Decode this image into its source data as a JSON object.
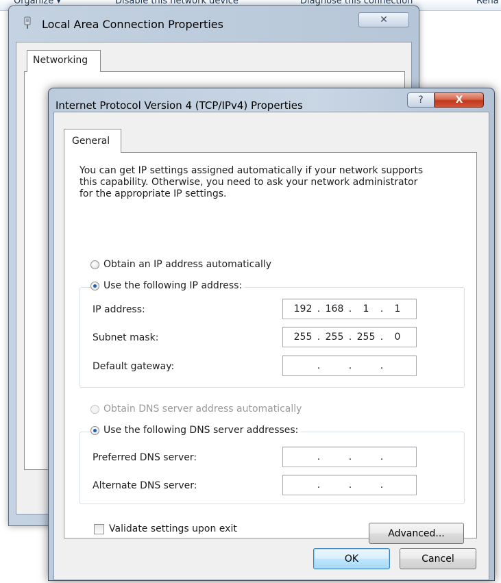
{
  "background_toolbar": {
    "organize": "Organize ▾",
    "disable_device": "Disable this network device",
    "diagnose": "Diagnose this connection",
    "rename": "Rena"
  },
  "back_window": {
    "title": "Local Area Connection Properties",
    "close_glyph": "✕",
    "tab_networking": "Networking"
  },
  "dialog": {
    "title": "Internet Protocol Version 4 (TCP/IPv4) Properties",
    "help_glyph": "?",
    "close_glyph": "X",
    "tab_general": "General",
    "intro": "You can get IP settings assigned automatically if your network supports\nthis capability. Otherwise, you need to ask your network administrator\nfor the appropriate IP settings.",
    "ip_mode": {
      "auto_label": "Obtain an IP address automatically",
      "manual_label": "Use the following IP address:",
      "selected": "manual"
    },
    "ip_fields": {
      "ip_address": {
        "label": "IP address:",
        "octets": [
          "192",
          "168",
          "1",
          "1"
        ]
      },
      "subnet_mask": {
        "label": "Subnet mask:",
        "octets": [
          "255",
          "255",
          "255",
          "0"
        ]
      },
      "default_gateway": {
        "label": "Default gateway:",
        "octets": [
          "",
          "",
          "",
          ""
        ]
      }
    },
    "dns_mode": {
      "auto_label": "Obtain DNS server address automatically",
      "manual_label": "Use the following DNS server addresses:",
      "selected": "manual",
      "auto_disabled": true
    },
    "dns_fields": {
      "preferred": {
        "label": "Preferred DNS server:",
        "octets": [
          "",
          "",
          "",
          ""
        ]
      },
      "alternate": {
        "label": "Alternate DNS server:",
        "octets": [
          "",
          "",
          "",
          ""
        ]
      }
    },
    "validate_label": "Validate settings upon exit",
    "validate_checked": false,
    "advanced_label": "Advanced...",
    "ok_label": "OK",
    "cancel_label": "Cancel"
  },
  "colors": {
    "title_close_red": "#c0371b",
    "default_button_blue": "#a7d9f5",
    "disabled_text": "#9a9a9a"
  }
}
